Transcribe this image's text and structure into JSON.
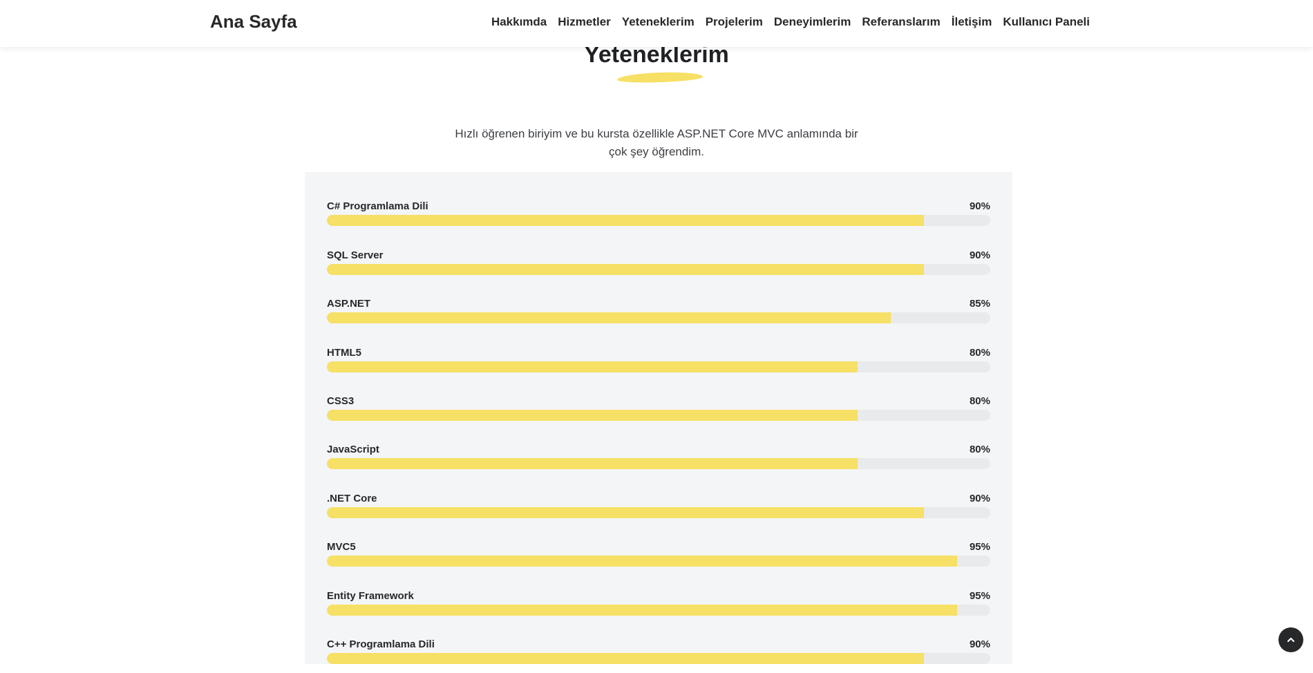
{
  "header": {
    "brand": "Ana Sayfa",
    "nav": [
      {
        "label": "Hakkımda"
      },
      {
        "label": "Hizmetler"
      },
      {
        "label": "Yeteneklerim"
      },
      {
        "label": "Projelerim"
      },
      {
        "label": "Deneyimlerim"
      },
      {
        "label": "Referanslarım"
      },
      {
        "label": "İletişim"
      },
      {
        "label": "Kullanıcı Paneli"
      }
    ]
  },
  "section": {
    "title": "Yeteneklerim",
    "description": "Hızlı öğrenen biriyim ve bu kursta özellikle ASP.NET Core MVC anlamında bir çok şey öğrendim."
  },
  "skills": [
    {
      "name": "C# Programlama Dili",
      "value_label": "90%",
      "percent": 90
    },
    {
      "name": "SQL Server",
      "value_label": "90%",
      "percent": 90
    },
    {
      "name": "ASP.NET",
      "value_label": "85%",
      "percent": 85
    },
    {
      "name": "HTML5",
      "value_label": "80%",
      "percent": 80
    },
    {
      "name": "CSS3",
      "value_label": "80%",
      "percent": 80
    },
    {
      "name": "JavaScript",
      "value_label": "80%",
      "percent": 80
    },
    {
      "name": ".NET Core",
      "value_label": "90%",
      "percent": 90
    },
    {
      "name": "MVC5",
      "value_label": "95%",
      "percent": 95
    },
    {
      "name": "Entity Framework",
      "value_label": "95%",
      "percent": 95
    },
    {
      "name": "C++ Programlama Dili",
      "value_label": "90%",
      "percent": 90
    }
  ],
  "colors": {
    "accent": "#f6e065",
    "track": "#e9eaec",
    "panel": "#f4f5f7",
    "text": "#272829"
  },
  "icons": {
    "back_to_top": "chevron-up-icon"
  }
}
